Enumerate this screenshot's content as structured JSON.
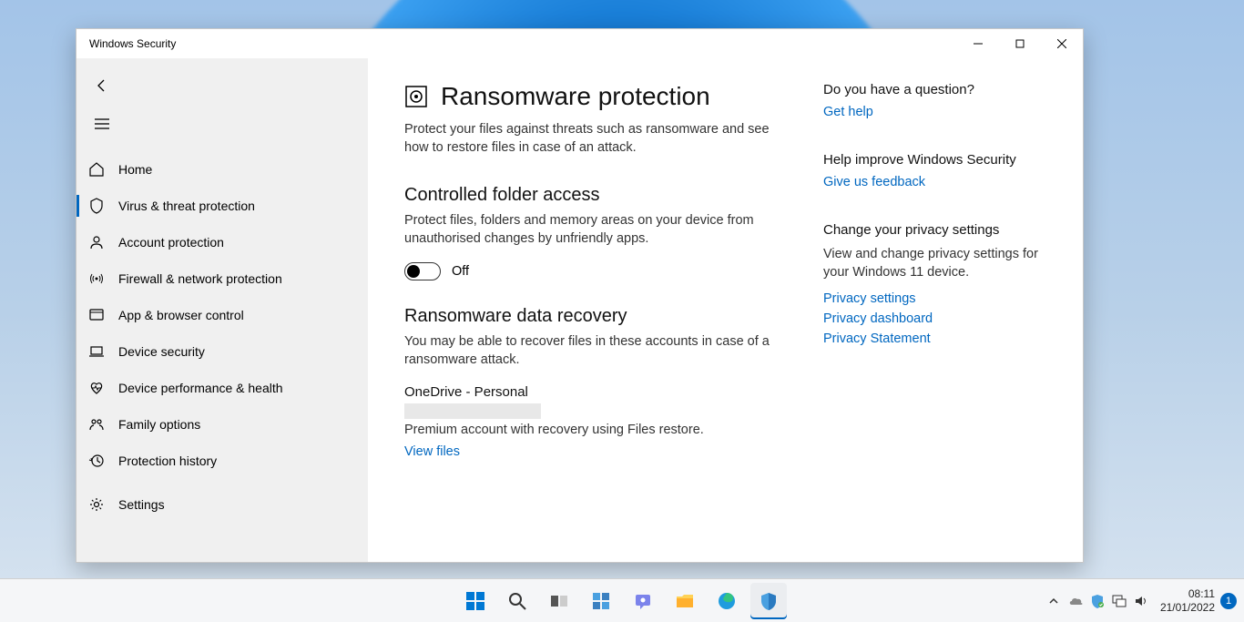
{
  "window": {
    "title": "Windows Security"
  },
  "sidebar": {
    "items": [
      {
        "id": "home",
        "label": "Home"
      },
      {
        "id": "virus",
        "label": "Virus & threat protection"
      },
      {
        "id": "account",
        "label": "Account protection"
      },
      {
        "id": "firewall",
        "label": "Firewall & network protection"
      },
      {
        "id": "appbrowser",
        "label": "App & browser control"
      },
      {
        "id": "devicesec",
        "label": "Device security"
      },
      {
        "id": "perfhealth",
        "label": "Device performance & health"
      },
      {
        "id": "family",
        "label": "Family options"
      },
      {
        "id": "history",
        "label": "Protection history"
      }
    ],
    "settings_label": "Settings"
  },
  "page": {
    "title": "Ransomware protection",
    "description": "Protect your files against threats such as ransomware and see how to restore files in case of an attack."
  },
  "controlled": {
    "title": "Controlled folder access",
    "description": "Protect files, folders and memory areas on your device from unauthorised changes by unfriendly apps.",
    "toggle_state": "Off"
  },
  "recovery": {
    "title": "Ransomware data recovery",
    "description": "You may be able to recover files in these accounts in case of a ransomware attack.",
    "account_name": "OneDrive - Personal",
    "account_desc": "Premium account with recovery using Files restore.",
    "view_files": "View files"
  },
  "right": {
    "question": {
      "title": "Do you have a question?",
      "link": "Get help"
    },
    "improve": {
      "title": "Help improve Windows Security",
      "link": "Give us feedback"
    },
    "privacy": {
      "title": "Change your privacy settings",
      "description": "View and change privacy settings for your Windows 11 device.",
      "links": [
        "Privacy settings",
        "Privacy dashboard",
        "Privacy Statement"
      ]
    }
  },
  "taskbar": {
    "time": "08:11",
    "date": "21/01/2022",
    "notification_count": "1"
  }
}
